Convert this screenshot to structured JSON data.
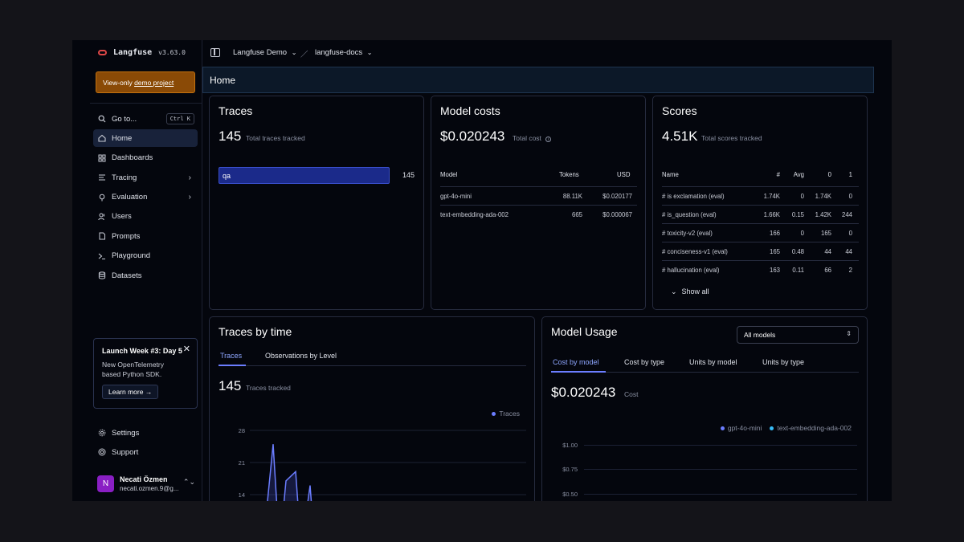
{
  "brand": {
    "name": "Langfuse",
    "version": "v3.63.0"
  },
  "notice": {
    "prefix": "View-only ",
    "link": "demo project"
  },
  "nav": {
    "goto": {
      "label": "Go to...",
      "shortcut": "Ctrl K"
    },
    "items": [
      {
        "label": "Home",
        "icon": "home-icon"
      },
      {
        "label": "Dashboards",
        "icon": "grid-icon"
      },
      {
        "label": "Tracing",
        "icon": "list-icon"
      },
      {
        "label": "Evaluation",
        "icon": "lightbulb-icon"
      },
      {
        "label": "Users",
        "icon": "users-icon"
      },
      {
        "label": "Prompts",
        "icon": "file-icon"
      },
      {
        "label": "Playground",
        "icon": "terminal-icon"
      },
      {
        "label": "Datasets",
        "icon": "database-icon"
      }
    ],
    "bottom": [
      {
        "label": "Settings",
        "icon": "gear-icon"
      },
      {
        "label": "Support",
        "icon": "lifebuoy-icon"
      }
    ]
  },
  "launch": {
    "title": "Launch Week #3: Day 5",
    "desc": "New OpenTelemetry based Python SDK.",
    "button": "Learn more →"
  },
  "user": {
    "initial": "N",
    "name": "Necati Özmen",
    "email": "necati.ozmen.9@g..."
  },
  "topbar": {
    "org": "Langfuse Demo",
    "project": "langfuse-docs"
  },
  "page": {
    "title": "Home"
  },
  "traces": {
    "title": "Traces",
    "count": "145",
    "count_label": "Total traces tracked",
    "bar": {
      "name": "qa",
      "value": "145",
      "fraction": 1.0
    }
  },
  "costs": {
    "title": "Model costs",
    "total": "$0.020243",
    "total_label": "Total cost",
    "headers": [
      "Model",
      "Tokens",
      "USD"
    ],
    "rows": [
      [
        "gpt-4o-mini",
        "88.11K",
        "$0.020177"
      ],
      [
        "text-embedding-ada-002",
        "665",
        "$0.000067"
      ]
    ]
  },
  "scores": {
    "title": "Scores",
    "total": "4.51K",
    "total_label": "Total scores tracked",
    "headers": [
      "Name",
      "#",
      "Avg",
      "0",
      "1"
    ],
    "rows": [
      [
        "# is exclamation (eval)",
        "1.74K",
        "0",
        "1.74K",
        "0"
      ],
      [
        "# is_question (eval)",
        "1.66K",
        "0.15",
        "1.42K",
        "244"
      ],
      [
        "# toxicity-v2 (eval)",
        "166",
        "0",
        "165",
        "0"
      ],
      [
        "# conciseness-v1 (eval)",
        "165",
        "0.48",
        "44",
        "44"
      ],
      [
        "# hallucination (eval)",
        "163",
        "0.11",
        "66",
        "2"
      ]
    ],
    "show_all": "Show all"
  },
  "traces_time": {
    "title": "Traces by time",
    "tabs": [
      "Traces",
      "Observations by Level"
    ],
    "count": "145",
    "count_label": "Traces tracked",
    "legend": "Traces",
    "color": "#6b7dff",
    "chart_data": {
      "type": "area",
      "y_ticks": [
        "28",
        "21",
        "14"
      ],
      "ylim": [
        0,
        28
      ],
      "series": [
        {
          "name": "Traces",
          "values": [
            2,
            25,
            2,
            17,
            19,
            2,
            16,
            2
          ]
        }
      ]
    }
  },
  "usage": {
    "title": "Model Usage",
    "select": "All models",
    "tabs": [
      "Cost by model",
      "Cost by type",
      "Units by model",
      "Units by type"
    ],
    "total": "$0.020243",
    "total_label": "Cost",
    "legend": [
      {
        "name": "gpt-4o-mini",
        "color": "#6b7dff"
      },
      {
        "name": "text-embedding-ada-002",
        "color": "#38bdf8"
      }
    ],
    "y_ticks": [
      "$1.00",
      "$0.75",
      "$0.50"
    ]
  }
}
